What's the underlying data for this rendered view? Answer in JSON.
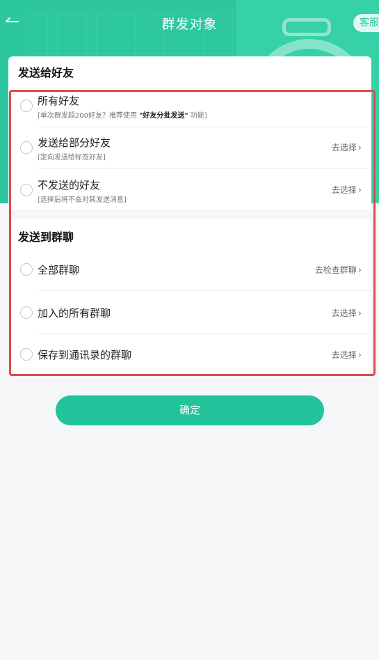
{
  "header": {
    "back_icon": "arrow-left-icon",
    "title": "群发对象",
    "service_label": "客服"
  },
  "friends_section": {
    "heading": "发送给好友",
    "items": [
      {
        "title": "所有好友",
        "subtitle_pre": "[单次群发超200好友？推荐使用 ",
        "subtitle_bold": "\"好友分批发送\"",
        "subtitle_post": " 功能]",
        "action": ""
      },
      {
        "title": "发送给部分好友",
        "subtitle": "[定向发送给标签好友]",
        "action": "去选择"
      },
      {
        "title": "不发送的好友",
        "subtitle": "[选择后将不会对其发送消息]",
        "action": "去选择"
      }
    ]
  },
  "groups_section": {
    "heading": "发送到群聊",
    "items": [
      {
        "title": "全部群聊",
        "action": "去检查群聊"
      },
      {
        "title": "加入的所有群聊",
        "action": "去选择"
      },
      {
        "title": "保存到通讯录的群聊",
        "action": "去选择"
      }
    ]
  },
  "confirm_label": "确定",
  "colors": {
    "brand": "#2cc79f",
    "button": "#22c39b",
    "highlight": "#e04a4a"
  }
}
